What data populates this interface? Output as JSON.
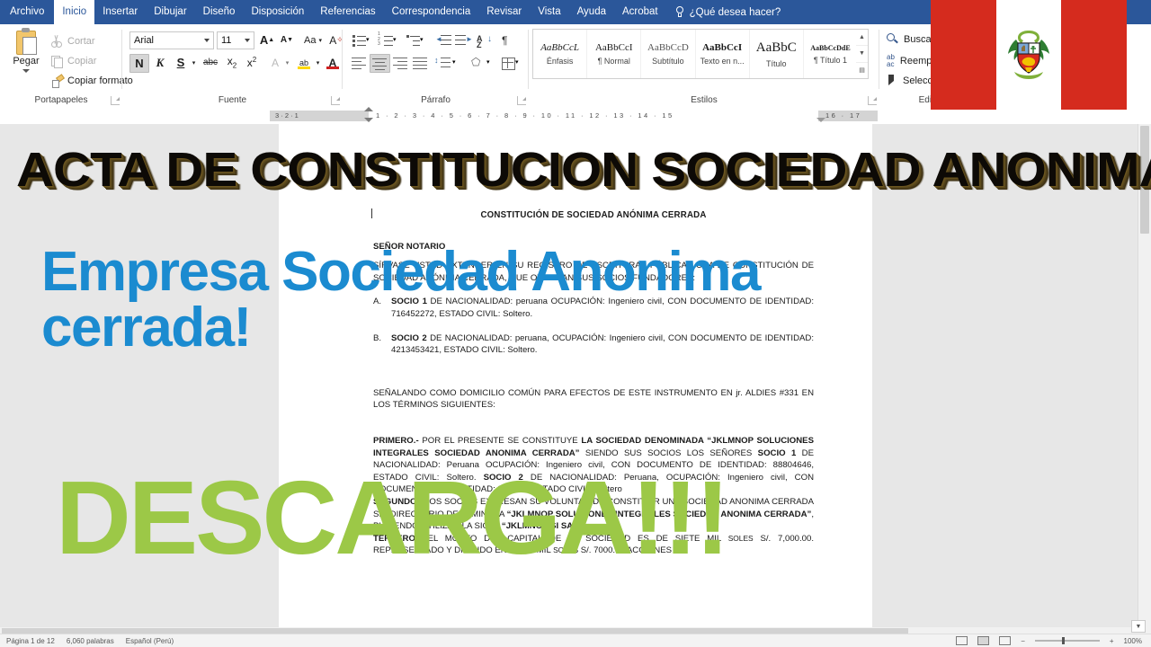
{
  "window": {
    "app": "Microsoft Word",
    "accent_blue": "#2b579a"
  },
  "ribbon_tabs": [
    {
      "label": "Archivo",
      "active": false,
      "file_tab": true
    },
    {
      "label": "Inicio",
      "active": true
    },
    {
      "label": "Insertar",
      "active": false
    },
    {
      "label": "Dibujar",
      "active": false
    },
    {
      "label": "Diseño",
      "active": false
    },
    {
      "label": "Disposición",
      "active": false
    },
    {
      "label": "Referencias",
      "active": false
    },
    {
      "label": "Correspondencia",
      "active": false
    },
    {
      "label": "Revisar",
      "active": false
    },
    {
      "label": "Vista",
      "active": false
    },
    {
      "label": "Ayuda",
      "active": false
    },
    {
      "label": "Acrobat",
      "active": false
    }
  ],
  "tell_me": {
    "icon": "lightbulb-icon",
    "label": "¿Qué desea hacer?"
  },
  "groups": {
    "clipboard": {
      "title": "Portapapeles",
      "paste_label": "Pegar",
      "items": [
        {
          "label": "Cortar",
          "icon": "scissors-icon",
          "enabled": false
        },
        {
          "label": "Copiar",
          "icon": "copy-icon",
          "enabled": false
        },
        {
          "label": "Copiar formato",
          "icon": "format-painter-icon",
          "enabled": true
        }
      ]
    },
    "font": {
      "title": "Fuente",
      "font_family_value": "Arial",
      "font_size_value": "11",
      "buttons": [
        {
          "name": "grow-font",
          "glyph": "A"
        },
        {
          "name": "shrink-font",
          "glyph": "A"
        },
        {
          "name": "change-case",
          "glyph": "Aa"
        },
        {
          "name": "clear-format",
          "glyph": "A"
        },
        {
          "name": "bold",
          "glyph": "N",
          "active": true
        },
        {
          "name": "italic",
          "glyph": "K"
        },
        {
          "name": "underline",
          "glyph": "S"
        },
        {
          "name": "strikethrough",
          "glyph": "abc"
        },
        {
          "name": "subscript",
          "glyph": "x2"
        },
        {
          "name": "superscript",
          "glyph": "x2"
        },
        {
          "name": "text-effects",
          "glyph": "A"
        },
        {
          "name": "highlight-color",
          "glyph": "ab"
        },
        {
          "name": "font-color",
          "glyph": "A"
        }
      ]
    },
    "paragraph": {
      "title": "Párrafo"
    },
    "styles": {
      "title": "Estilos",
      "items": [
        {
          "sample": "AaBbCcL",
          "name": "Énfasis"
        },
        {
          "sample": "AaBbCcI",
          "name": "¶ Normal"
        },
        {
          "sample": "AaBbCcD",
          "name": "Subtítulo"
        },
        {
          "sample": "AaBbCcI",
          "name": "Texto en n..."
        },
        {
          "sample": "AaBbC",
          "name": "Título"
        },
        {
          "sample": "AaBbCcDdE",
          "name": "¶ Título 1"
        }
      ]
    },
    "editing": {
      "title": "Edición",
      "items": [
        {
          "label": "Buscar",
          "icon": "search-icon"
        },
        {
          "label": "Reemplazar",
          "icon": "replace-icon"
        },
        {
          "label": "Seleccionar",
          "icon": "select-cursor-icon"
        }
      ]
    }
  },
  "ruler": {
    "left_marks": "3  ·  2  ·  1",
    "right_marks": "1 · 2 · 3 · 4 · 5 · 6 · 7 · 8 · 9 · 10 · 11 · 12 · 13 · 14 · 15",
    "tail_marks": "16 · 17"
  },
  "document": {
    "heading": "CONSTITUCIÓN DE SOCIEDAD ANÓNIMA CERRADA",
    "salutation": "SEÑOR NOTARIO",
    "intro": "SÍRVASE USTED EXTENDER EN SU REGISTRO DE ESCRITURAS PÚBLICAS UNA DE CONSTITUCIÓN DE SOCIEDAD ANÓNIMA CERRADA, QUE OTORGAN SUS SOCIOS FUNDADORES:",
    "partners": [
      {
        "marker": "A.",
        "name": "SOCIO 1",
        "text": " DE NACIONALIDAD: peruana OCUPACIÓN: Ingeniero civil, CON DOCUMENTO DE IDENTIDAD: 716452272, ESTADO CIVIL: Soltero."
      },
      {
        "marker": "B.",
        "name": "SOCIO 2",
        "text": " DE NACIONALIDAD: peruana, OCUPACIÓN: Ingeniero civil, CON DOCUMENTO DE IDENTIDAD: 4213453421, ESTADO CIVIL: Soltero."
      }
    ],
    "domicile": "SEÑALANDO COMO DOMICILIO COMÚN PARA EFECTOS DE ESTE INSTRUMENTO EN jr. ALDIES #331 EN LOS TÉRMINOS SIGUIENTES:",
    "clauses": [
      {
        "label": "PRIMERO.-",
        "segments": [
          {
            "text": " POR EL PRESENTE SE CONSTITUYE ",
            "bold": false
          },
          {
            "text": "LA SOCIEDAD DENOMINADA “JKLMNOP SOLUCIONES INTEGRALES SOCIEDAD ANONIMA CERRADA”",
            "bold": true
          },
          {
            "text": " SIENDO SUS SOCIOS LOS SEÑORES ",
            "bold": false
          },
          {
            "text": "SOCIO 1",
            "bold": true
          },
          {
            "text": " DE NACIONALIDAD: Peruana OCUPACIÓN: Ingeniero civil, CON DOCUMENTO DE IDENTIDAD: 88804646, ESTADO CIVIL: Soltero. ",
            "bold": false
          },
          {
            "text": "SOCIO 2",
            "bold": true
          },
          {
            "text": " DE NACIONALIDAD: Peruana, OCUPACIÓN: Ingeniero civil, CON DOCUMENTO DE IDENTIDAD: 231222, ESTADO CIVIL: Soltero",
            "bold": false
          }
        ]
      },
      {
        "label": "SEGUNDO.-",
        "segments": [
          {
            "text": " LOS SOCIOS EXPRESAN SU VOLUNTAD DE CONSTITUIR UNA SOCIEDAD ANONIMA CERRADA SIN DIRECTORIO DENOMINADA ",
            "bold": false
          },
          {
            "text": "“JKLMNOP SOLUCIONES INTEGRALES SOCIEDAD ANONIMA CERRADA”",
            "bold": true
          },
          {
            "text": ", PUDIENDO UTILIZAR LA SIGLA ",
            "bold": false
          },
          {
            "text": "“JKLMNOP SI SAC”",
            "bold": true
          }
        ]
      },
      {
        "label": "TERCERO.-",
        "segments": [
          {
            "text": " EL MONTO DEL CAPITAL DE LA SOCIEDAD ES DE SIETE MIL ",
            "bold": false
          },
          {
            "text": "SOLES",
            "bold": false,
            "small": true
          },
          {
            "text": " S/. 7,000.00. REPRESENTADO Y DIVIDIDO EN SIETE MIL ",
            "bold": false
          },
          {
            "text": "SOLES",
            "bold": false,
            "small": true
          },
          {
            "text": " S/. 7000.00 ACCIONES",
            "bold": false
          }
        ]
      }
    ]
  },
  "overlays": {
    "title": "ACTA DE CONSTITUCION SOCIEDAD ANONIMA",
    "title_color": "#0d0a06",
    "subtitle_line1": "Empresa Sociedad Anonima",
    "subtitle_line2": "cerrada!",
    "subtitle_color": "#1b8bd0",
    "cta": "DESCARGA!!!",
    "cta_color": "#9cc847",
    "flag": {
      "name": "peru-flag",
      "red": "#d52b1e",
      "white": "#ffffff",
      "emblem": "coat-of-arms-of-peru"
    }
  },
  "status_bar": {
    "page_info": "Página 1 de 12",
    "word_count": "6,060 palabras",
    "language": "Español (Perú)",
    "zoom": "100%"
  }
}
